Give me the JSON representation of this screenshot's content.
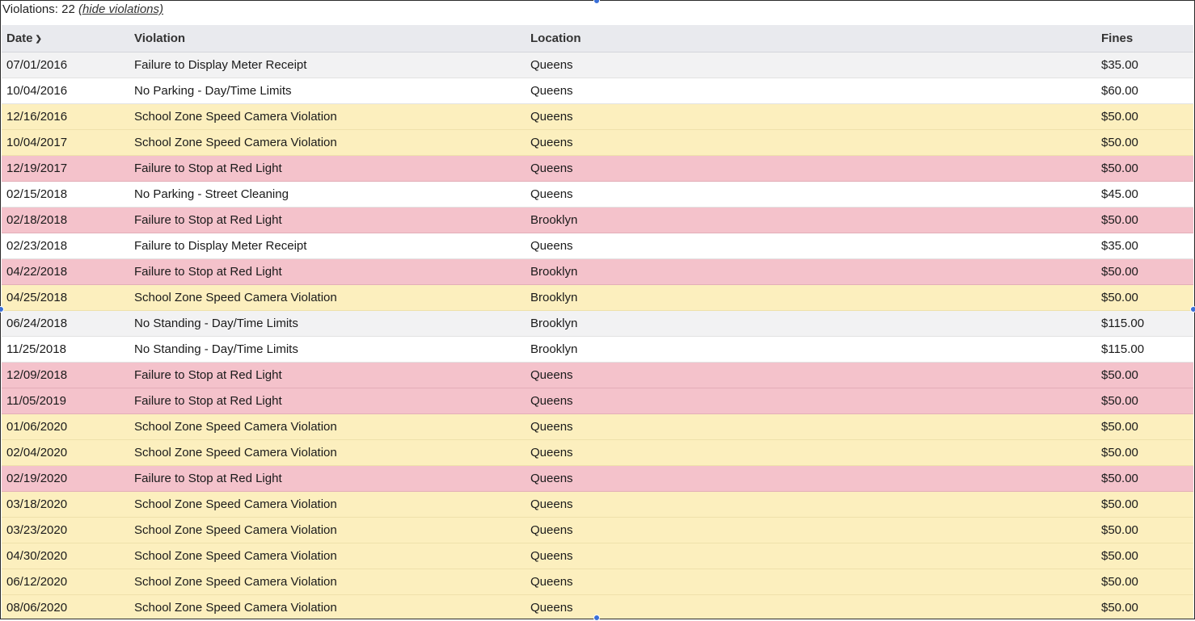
{
  "summary": {
    "prefix": "Violations: 22",
    "toggle_label": "(hide violations)"
  },
  "columns": {
    "date": "Date",
    "violation": "Violation",
    "location": "Location",
    "fines": "Fines"
  },
  "row_colors": {
    "neutral": "#f2f2f3",
    "white": "#ffffff",
    "yellow": "#fcefbe",
    "red": "#f4c2cb"
  },
  "rows": [
    {
      "date": "07/01/2016",
      "violation": "Failure to Display Meter Receipt",
      "location": "Queens",
      "fine": "$35.00",
      "tone": "neutral"
    },
    {
      "date": "10/04/2016",
      "violation": "No Parking - Day/Time Limits",
      "location": "Queens",
      "fine": "$60.00",
      "tone": "white"
    },
    {
      "date": "12/16/2016",
      "violation": "School Zone Speed Camera Violation",
      "location": "Queens",
      "fine": "$50.00",
      "tone": "yellow"
    },
    {
      "date": "10/04/2017",
      "violation": "School Zone Speed Camera Violation",
      "location": "Queens",
      "fine": "$50.00",
      "tone": "yellow"
    },
    {
      "date": "12/19/2017",
      "violation": "Failure to Stop at Red Light",
      "location": "Queens",
      "fine": "$50.00",
      "tone": "red"
    },
    {
      "date": "02/15/2018",
      "violation": "No Parking - Street Cleaning",
      "location": "Queens",
      "fine": "$45.00",
      "tone": "white"
    },
    {
      "date": "02/18/2018",
      "violation": "Failure to Stop at Red Light",
      "location": "Brooklyn",
      "fine": "$50.00",
      "tone": "red"
    },
    {
      "date": "02/23/2018",
      "violation": "Failure to Display Meter Receipt",
      "location": "Queens",
      "fine": "$35.00",
      "tone": "white"
    },
    {
      "date": "04/22/2018",
      "violation": "Failure to Stop at Red Light",
      "location": "Brooklyn",
      "fine": "$50.00",
      "tone": "red"
    },
    {
      "date": "04/25/2018",
      "violation": "School Zone Speed Camera Violation",
      "location": "Brooklyn",
      "fine": "$50.00",
      "tone": "yellow"
    },
    {
      "date": "06/24/2018",
      "violation": "No Standing - Day/Time Limits",
      "location": "Brooklyn",
      "fine": "$115.00",
      "tone": "neutral"
    },
    {
      "date": "11/25/2018",
      "violation": "No Standing - Day/Time Limits",
      "location": "Brooklyn",
      "fine": "$115.00",
      "tone": "white"
    },
    {
      "date": "12/09/2018",
      "violation": "Failure to Stop at Red Light",
      "location": "Queens",
      "fine": "$50.00",
      "tone": "red"
    },
    {
      "date": "11/05/2019",
      "violation": "Failure to Stop at Red Light",
      "location": "Queens",
      "fine": "$50.00",
      "tone": "red"
    },
    {
      "date": "01/06/2020",
      "violation": "School Zone Speed Camera Violation",
      "location": "Queens",
      "fine": "$50.00",
      "tone": "yellow"
    },
    {
      "date": "02/04/2020",
      "violation": "School Zone Speed Camera Violation",
      "location": "Queens",
      "fine": "$50.00",
      "tone": "yellow"
    },
    {
      "date": "02/19/2020",
      "violation": "Failure to Stop at Red Light",
      "location": "Queens",
      "fine": "$50.00",
      "tone": "red"
    },
    {
      "date": "03/18/2020",
      "violation": "School Zone Speed Camera Violation",
      "location": "Queens",
      "fine": "$50.00",
      "tone": "yellow"
    },
    {
      "date": "03/23/2020",
      "violation": "School Zone Speed Camera Violation",
      "location": "Queens",
      "fine": "$50.00",
      "tone": "yellow"
    },
    {
      "date": "04/30/2020",
      "violation": "School Zone Speed Camera Violation",
      "location": "Queens",
      "fine": "$50.00",
      "tone": "yellow"
    },
    {
      "date": "06/12/2020",
      "violation": "School Zone Speed Camera Violation",
      "location": "Queens",
      "fine": "$50.00",
      "tone": "yellow"
    },
    {
      "date": "08/06/2020",
      "violation": "School Zone Speed Camera Violation",
      "location": "Queens",
      "fine": "$50.00",
      "tone": "yellow"
    }
  ],
  "icons": {
    "sort": "chevron-down-icon"
  }
}
